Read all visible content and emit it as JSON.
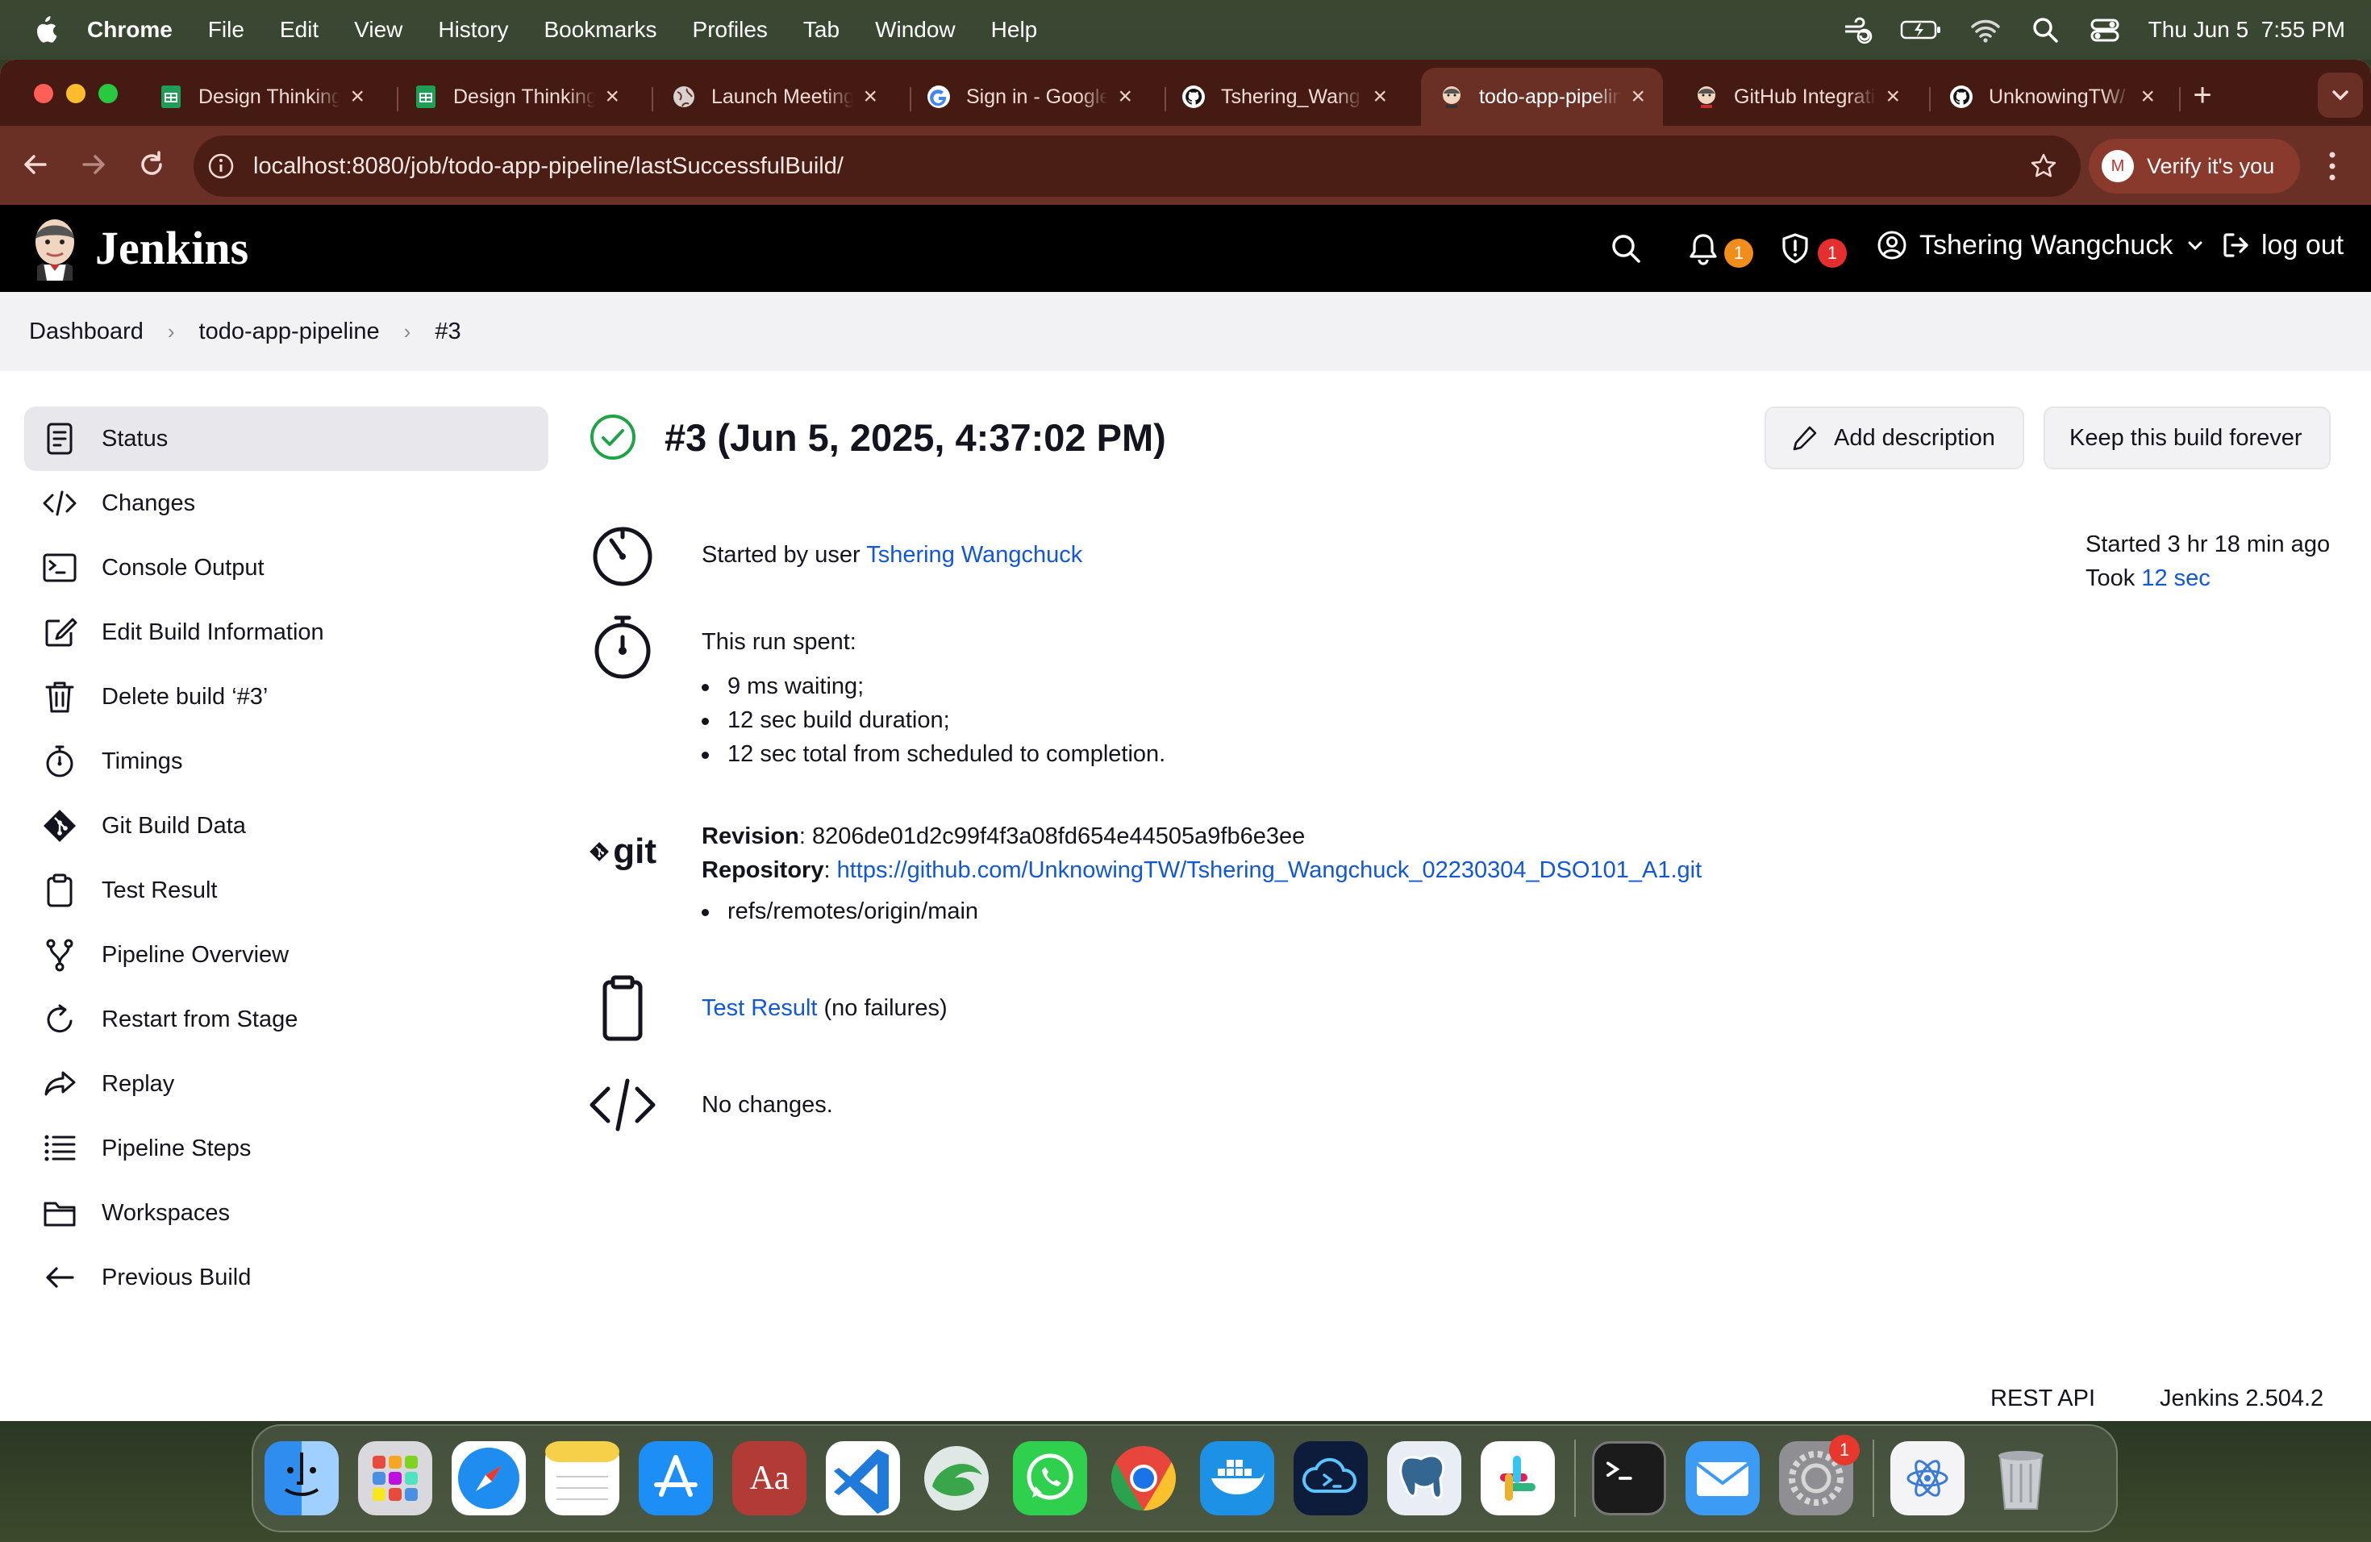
{
  "menubar": {
    "app": "Chrome",
    "items": [
      "File",
      "Edit",
      "View",
      "History",
      "Bookmarks",
      "Profiles",
      "Tab",
      "Window",
      "Help"
    ],
    "clock": "Thu Jun 5  7:55 PM"
  },
  "browser": {
    "tabs": [
      {
        "title": "Design Thinking",
        "icon": "sheets-icon"
      },
      {
        "title": "Design Thinking",
        "icon": "sheets-icon"
      },
      {
        "title": "Launch Meeting",
        "icon": "globe-icon"
      },
      {
        "title": "Sign in - Google",
        "icon": "google-icon"
      },
      {
        "title": "Tshering_Wang",
        "icon": "github-icon"
      },
      {
        "title": "todo-app-pipeline",
        "icon": "jenkins-icon",
        "active": true
      },
      {
        "title": "GitHub Integration",
        "icon": "jenkins-icon"
      },
      {
        "title": "UnknowingTW/",
        "icon": "github-icon"
      }
    ],
    "url": "localhost:8080/job/todo-app-pipeline/lastSuccessfulBuild/",
    "verify_label": "Verify it's you",
    "verify_avatar": "M"
  },
  "jenkins": {
    "brand": "Jenkins",
    "notifications_count": "1",
    "security_count": "1",
    "user": "Tshering Wangchuck",
    "logout": "log out"
  },
  "breadcrumb": [
    "Dashboard",
    "todo-app-pipeline",
    "#3"
  ],
  "sidebar": [
    {
      "label": "Status",
      "icon": "status-icon",
      "active": true
    },
    {
      "label": "Changes",
      "icon": "code-icon"
    },
    {
      "label": "Console Output",
      "icon": "terminal-icon"
    },
    {
      "label": "Edit Build Information",
      "icon": "edit-icon"
    },
    {
      "label": "Delete build ‘#3’",
      "icon": "trash-icon"
    },
    {
      "label": "Timings",
      "icon": "stopwatch-icon"
    },
    {
      "label": "Git Build Data",
      "icon": "git-icon"
    },
    {
      "label": "Test Result",
      "icon": "clipboard-icon"
    },
    {
      "label": "Pipeline Overview",
      "icon": "branch-icon"
    },
    {
      "label": "Restart from Stage",
      "icon": "restart-icon"
    },
    {
      "label": "Replay",
      "icon": "replay-icon"
    },
    {
      "label": "Pipeline Steps",
      "icon": "list-icon"
    },
    {
      "label": "Workspaces",
      "icon": "folder-icon"
    },
    {
      "label": "Previous Build",
      "icon": "arrow-left-icon"
    }
  ],
  "build": {
    "title": "#3 (Jun 5, 2025, 4:37:02 PM)",
    "add_description": "Add description",
    "keep_forever": "Keep this build forever",
    "started_by_prefix": "Started by user ",
    "started_by_user": "Tshering Wangchuck",
    "started_ago": "Started 3 hr 18 min ago",
    "took_prefix": "Took ",
    "took_value": "12 sec",
    "run_spent_label": "This run spent:",
    "run_spent": [
      "9 ms waiting;",
      "12 sec build duration;",
      "12 sec total from scheduled to completion."
    ],
    "git_label": "git",
    "revision_label": "Revision",
    "revision": "8206de01d2c99f4f3a08fd654e44505a9fb6e3ee",
    "repository_label": "Repository",
    "repository": "https://github.com/UnknowingTW/Tshering_Wangchuck_02230304_DSO101_A1.git",
    "refs": [
      "refs/remotes/origin/main"
    ],
    "test_result_link": "Test Result",
    "test_result_note": " (no failures)",
    "changes_text": "No changes."
  },
  "footer": {
    "rest_api": "REST API",
    "version": "Jenkins 2.504.2"
  },
  "dock": {
    "apps": [
      "finder-icon",
      "launchpad-icon",
      "safari-icon",
      "notes-icon",
      "app-store-icon",
      "dictionary-icon",
      "vscode-icon",
      "edge-like-icon",
      "whatsapp-icon",
      "chrome-icon",
      "docker-icon",
      "cloud-terminal-icon",
      "postgres-icon",
      "slack-icon",
      "terminal-icon",
      "mail-icon",
      "settings-icon",
      "react-doc-icon",
      "trash-icon"
    ],
    "settings_badge": "1"
  }
}
